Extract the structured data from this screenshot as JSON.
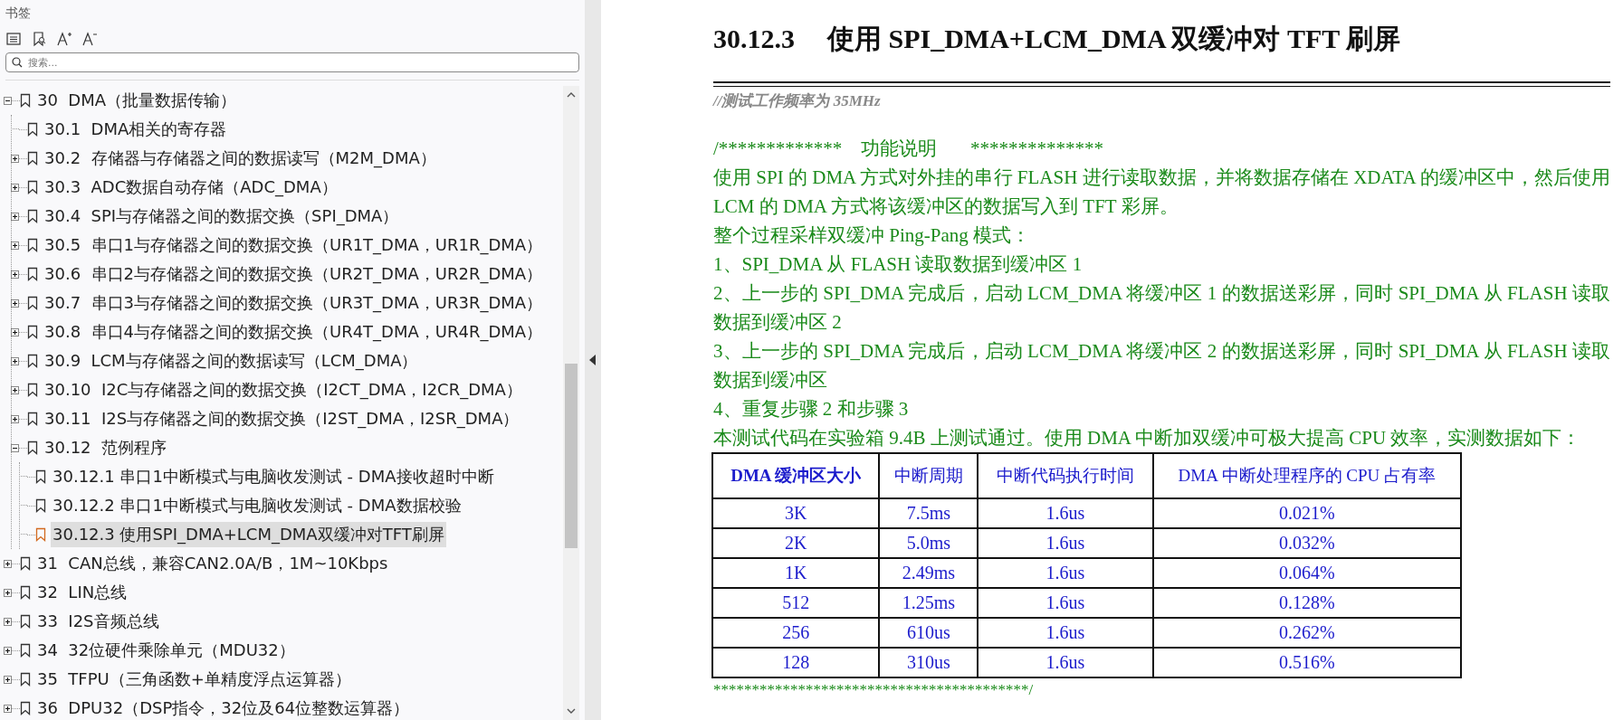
{
  "sidebar": {
    "title": "书签",
    "search": {
      "placeholder": "搜索..."
    },
    "tree": [
      {
        "label": "30  DMA（批量数据传输）",
        "kind": "branch",
        "expanded": true,
        "selected": false,
        "children": [
          {
            "label": "30.1  DMA相关的寄存器",
            "kind": "leaf",
            "selected": false
          },
          {
            "label": "30.2  存储器与存储器之间的数据读写（M2M_DMA）",
            "kind": "branch",
            "expanded": false,
            "selected": false
          },
          {
            "label": "30.3  ADC数据自动存储（ADC_DMA）",
            "kind": "branch",
            "expanded": false,
            "selected": false
          },
          {
            "label": "30.4  SPI与存储器之间的数据交换（SPI_DMA）",
            "kind": "branch",
            "expanded": false,
            "selected": false
          },
          {
            "label": "30.5  串口1与存储器之间的数据交换（UR1T_DMA，UR1R_DMA）",
            "kind": "branch",
            "expanded": false,
            "selected": false
          },
          {
            "label": "30.6  串口2与存储器之间的数据交换（UR2T_DMA，UR2R_DMA）",
            "kind": "branch",
            "expanded": false,
            "selected": false
          },
          {
            "label": "30.7  串口3与存储器之间的数据交换（UR3T_DMA，UR3R_DMA）",
            "kind": "branch",
            "expanded": false,
            "selected": false
          },
          {
            "label": "30.8  串口4与存储器之间的数据交换（UR4T_DMA，UR4R_DMA）",
            "kind": "branch",
            "expanded": false,
            "selected": false
          },
          {
            "label": "30.9  LCM与存储器之间的数据读写（LCM_DMA）",
            "kind": "branch",
            "expanded": false,
            "selected": false
          },
          {
            "label": "30.10  I2C与存储器之间的数据交换（I2CT_DMA，I2CR_DMA）",
            "kind": "branch",
            "expanded": false,
            "selected": false
          },
          {
            "label": "30.11  I2S与存储器之间的数据交换（I2ST_DMA，I2SR_DMA）",
            "kind": "branch",
            "expanded": false,
            "selected": false
          },
          {
            "label": "30.12  范例程序",
            "kind": "branch",
            "expanded": true,
            "selected": false,
            "children": [
              {
                "label": "30.12.1 串口1中断模式与电脑收发测试 - DMA接收超时中断",
                "kind": "leaf",
                "selected": false
              },
              {
                "label": "30.12.2 串口1中断模式与电脑收发测试 - DMA数据校验",
                "kind": "leaf",
                "selected": false
              },
              {
                "label": "30.12.3 使用SPI_DMA+LCM_DMA双缓冲对TFT刷屏",
                "kind": "leaf",
                "selected": true
              }
            ]
          }
        ]
      },
      {
        "label": "31  CAN总线，兼容CAN2.0A/B，1M~10Kbps",
        "kind": "branch",
        "expanded": false,
        "selected": false
      },
      {
        "label": "32  LIN总线",
        "kind": "branch",
        "expanded": false,
        "selected": false
      },
      {
        "label": "33  I2S音频总线",
        "kind": "branch",
        "expanded": false,
        "selected": false
      },
      {
        "label": "34  32位硬件乘除单元（MDU32）",
        "kind": "branch",
        "expanded": false,
        "selected": false
      },
      {
        "label": "35  TFPU（三角函数+单精度浮点运算器）",
        "kind": "branch",
        "expanded": false,
        "selected": false
      },
      {
        "label": "36  DPU32（DSP指令，32位及64位整数运算器）",
        "kind": "branch",
        "expanded": false,
        "selected": false
      }
    ]
  },
  "document": {
    "heading_number": "30.12.3",
    "heading": "使用 SPI_DMA+LCM_DMA 双缓冲对 TFT 刷屏",
    "comment": "//测试工作频率为 35MHz",
    "lines": [
      {
        "kind": "rule",
        "text": "/*************    功能说明       **************"
      },
      {
        "kind": "text",
        "text": "使用 SPI 的 DMA 方式对外挂的串行 FLASH 进行读取数据，并将数据存储在 XDATA 的缓冲区中，然后使用 LCM 的 DMA 方式将该缓冲区的数据写入到 TFT 彩屏。"
      },
      {
        "kind": "text",
        "text": "整个过程采样双缓冲 Ping-Pang 模式："
      },
      {
        "kind": "text",
        "text": "1、SPI_DMA 从 FLASH 读取数据到缓冲区 1"
      },
      {
        "kind": "text",
        "text": "2、上一步的 SPI_DMA 完成后，启动 LCM_DMA 将缓冲区 1 的数据送彩屏，同时 SPI_DMA 从 FLASH 读取数据到缓冲区 2"
      },
      {
        "kind": "text",
        "text": "3、上一步的 SPI_DMA 完成后，启动 LCM_DMA 将缓冲区 2 的数据送彩屏，同时 SPI_DMA 从 FLASH 读取数据到缓冲区"
      },
      {
        "kind": "text",
        "text": "4、重复步骤 2 和步骤 3"
      },
      {
        "kind": "text",
        "text": "本测试代码在实验箱 9.4B 上测试通过。使用 DMA 中断加双缓冲可极大提高 CPU 效率，实测数据如下："
      }
    ],
    "table": {
      "columns": [
        "DMA 缓冲区大小",
        "中断周期",
        "中断代码执行时间",
        "DMA 中断处理程序的 CPU 占有率"
      ],
      "rows": [
        [
          "3K",
          "7.5ms",
          "1.6us",
          "0.021%"
        ],
        [
          "2K",
          "5.0ms",
          "1.6us",
          "0.032%"
        ],
        [
          "1K",
          "2.49ms",
          "1.6us",
          "0.064%"
        ],
        [
          "512",
          "1.25ms",
          "1.6us",
          "0.128%"
        ],
        [
          "256",
          "610us",
          "1.6us",
          "0.262%"
        ],
        [
          "128",
          "310us",
          "1.6us",
          "0.516%"
        ]
      ]
    },
    "closing": "*****************************************/"
  }
}
